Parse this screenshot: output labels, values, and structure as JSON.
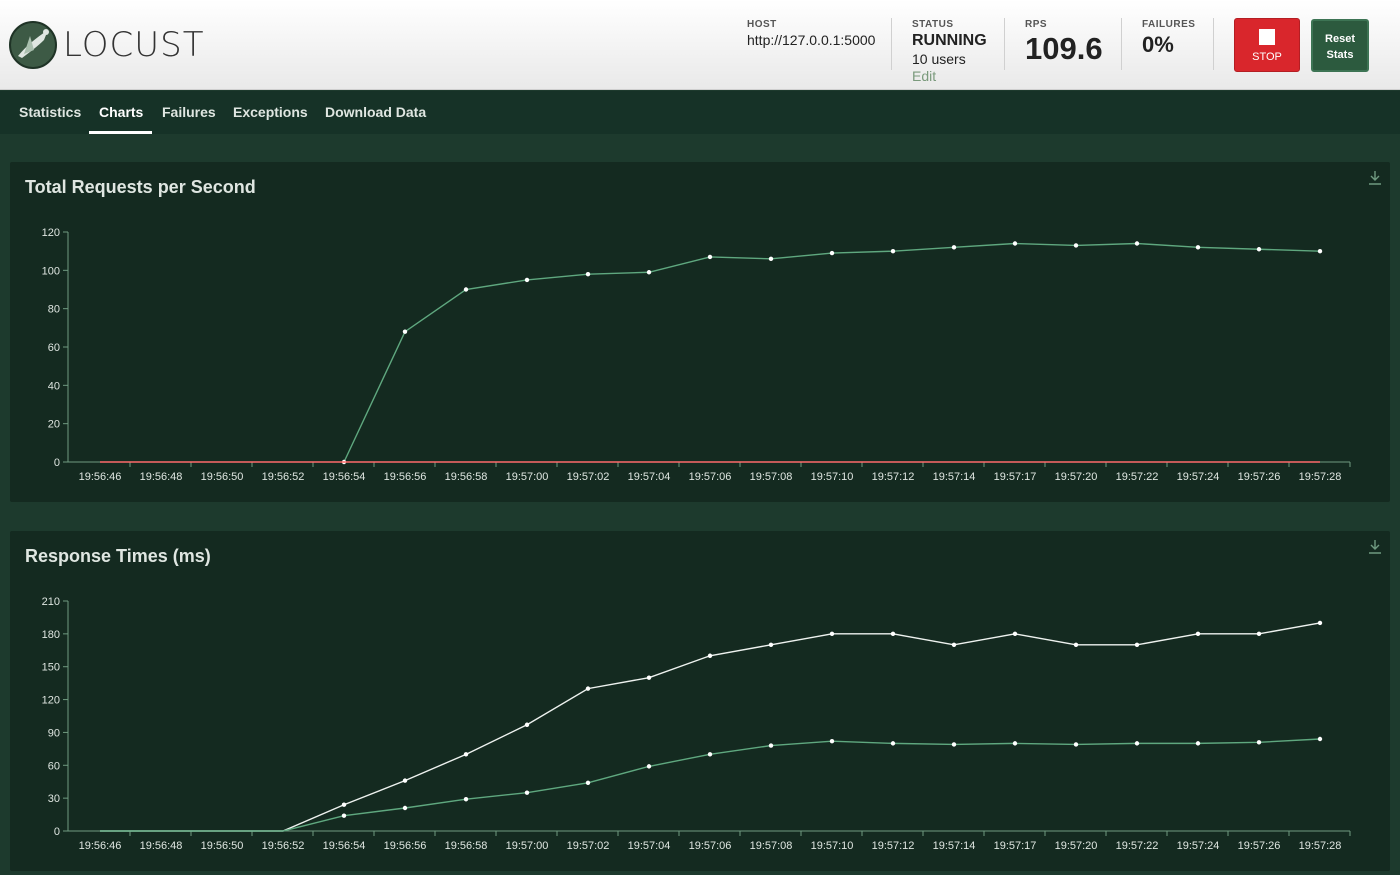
{
  "app": {
    "brand": "LOCUST"
  },
  "header": {
    "host_label": "HOST",
    "host_value": "http://127.0.0.1:5000",
    "status_label": "STATUS",
    "status_value": "RUNNING",
    "users": "10 users",
    "edit_label": "Edit",
    "rps_label": "RPS",
    "rps_value": "109.6",
    "failures_label": "FAILURES",
    "failures_value": "0%",
    "stop_label": "STOP",
    "reset_label": "Reset Stats"
  },
  "nav": {
    "tabs": [
      {
        "label": "Statistics",
        "active": false
      },
      {
        "label": "Charts",
        "active": true
      },
      {
        "label": "Failures",
        "active": false
      },
      {
        "label": "Exceptions",
        "active": false
      },
      {
        "label": "Download Data",
        "active": false
      }
    ]
  },
  "colors": {
    "header_bg": "#ffffff",
    "page_bg": "#1d3a2d",
    "panel_bg": "#142a20",
    "stop": "#d9262c",
    "reset": "#2c5a3e",
    "rps_line": "#5fa87f",
    "fail_line": "#ff6b6b",
    "p95_line": "#eef2ef",
    "median_line": "#5fa87f"
  },
  "icons": {
    "logo": "locust-logo",
    "download": "download-icon",
    "stop": "stop-square-icon"
  },
  "chart_data": [
    {
      "type": "line",
      "title": "Total Requests per Second",
      "x": [
        "19:56:46",
        "19:56:48",
        "19:56:50",
        "19:56:52",
        "19:56:54",
        "19:56:56",
        "19:56:58",
        "19:57:00",
        "19:57:02",
        "19:57:04",
        "19:57:06",
        "19:57:08",
        "19:57:10",
        "19:57:12",
        "19:57:14",
        "19:57:17",
        "19:57:20",
        "19:57:22",
        "19:57:24",
        "19:57:26",
        "19:57:28"
      ],
      "ylim": [
        0,
        120
      ],
      "yticks": [
        0,
        20,
        40,
        60,
        80,
        100,
        120
      ],
      "series": [
        {
          "values": [
            null,
            null,
            null,
            null,
            0,
            68,
            90,
            95,
            98,
            99,
            107,
            106,
            109,
            110,
            112,
            114,
            113,
            114,
            112,
            111,
            110
          ],
          "color": "#5fa87f",
          "markers": true
        },
        {
          "values": [
            0,
            0,
            0,
            0,
            0,
            0,
            0,
            0,
            0,
            0,
            0,
            0,
            0,
            0,
            0,
            0,
            0,
            0,
            0,
            0,
            0
          ],
          "color": "#ff6b6b",
          "markers": false
        }
      ]
    },
    {
      "type": "line",
      "title": "Response Times (ms)",
      "x": [
        "19:56:46",
        "19:56:48",
        "19:56:50",
        "19:56:52",
        "19:56:54",
        "19:56:56",
        "19:56:58",
        "19:57:00",
        "19:57:02",
        "19:57:04",
        "19:57:06",
        "19:57:08",
        "19:57:10",
        "19:57:12",
        "19:57:14",
        "19:57:17",
        "19:57:20",
        "19:57:22",
        "19:57:24",
        "19:57:26",
        "19:57:28"
      ],
      "ylim": [
        0,
        210
      ],
      "yticks": [
        0,
        30,
        60,
        90,
        120,
        150,
        180,
        210
      ],
      "series": [
        {
          "values": [
            0,
            0,
            0,
            0,
            24,
            46,
            70,
            97,
            130,
            140,
            160,
            170,
            180,
            180,
            170,
            180,
            170,
            170,
            180,
            180,
            190
          ],
          "color": "#eef2ef",
          "markers": true
        },
        {
          "values": [
            0,
            0,
            0,
            0,
            14,
            21,
            29,
            35,
            44,
            59,
            70,
            78,
            82,
            80,
            79,
            80,
            79,
            80,
            80,
            81,
            84
          ],
          "color": "#5fa87f",
          "markers": true
        }
      ]
    }
  ]
}
